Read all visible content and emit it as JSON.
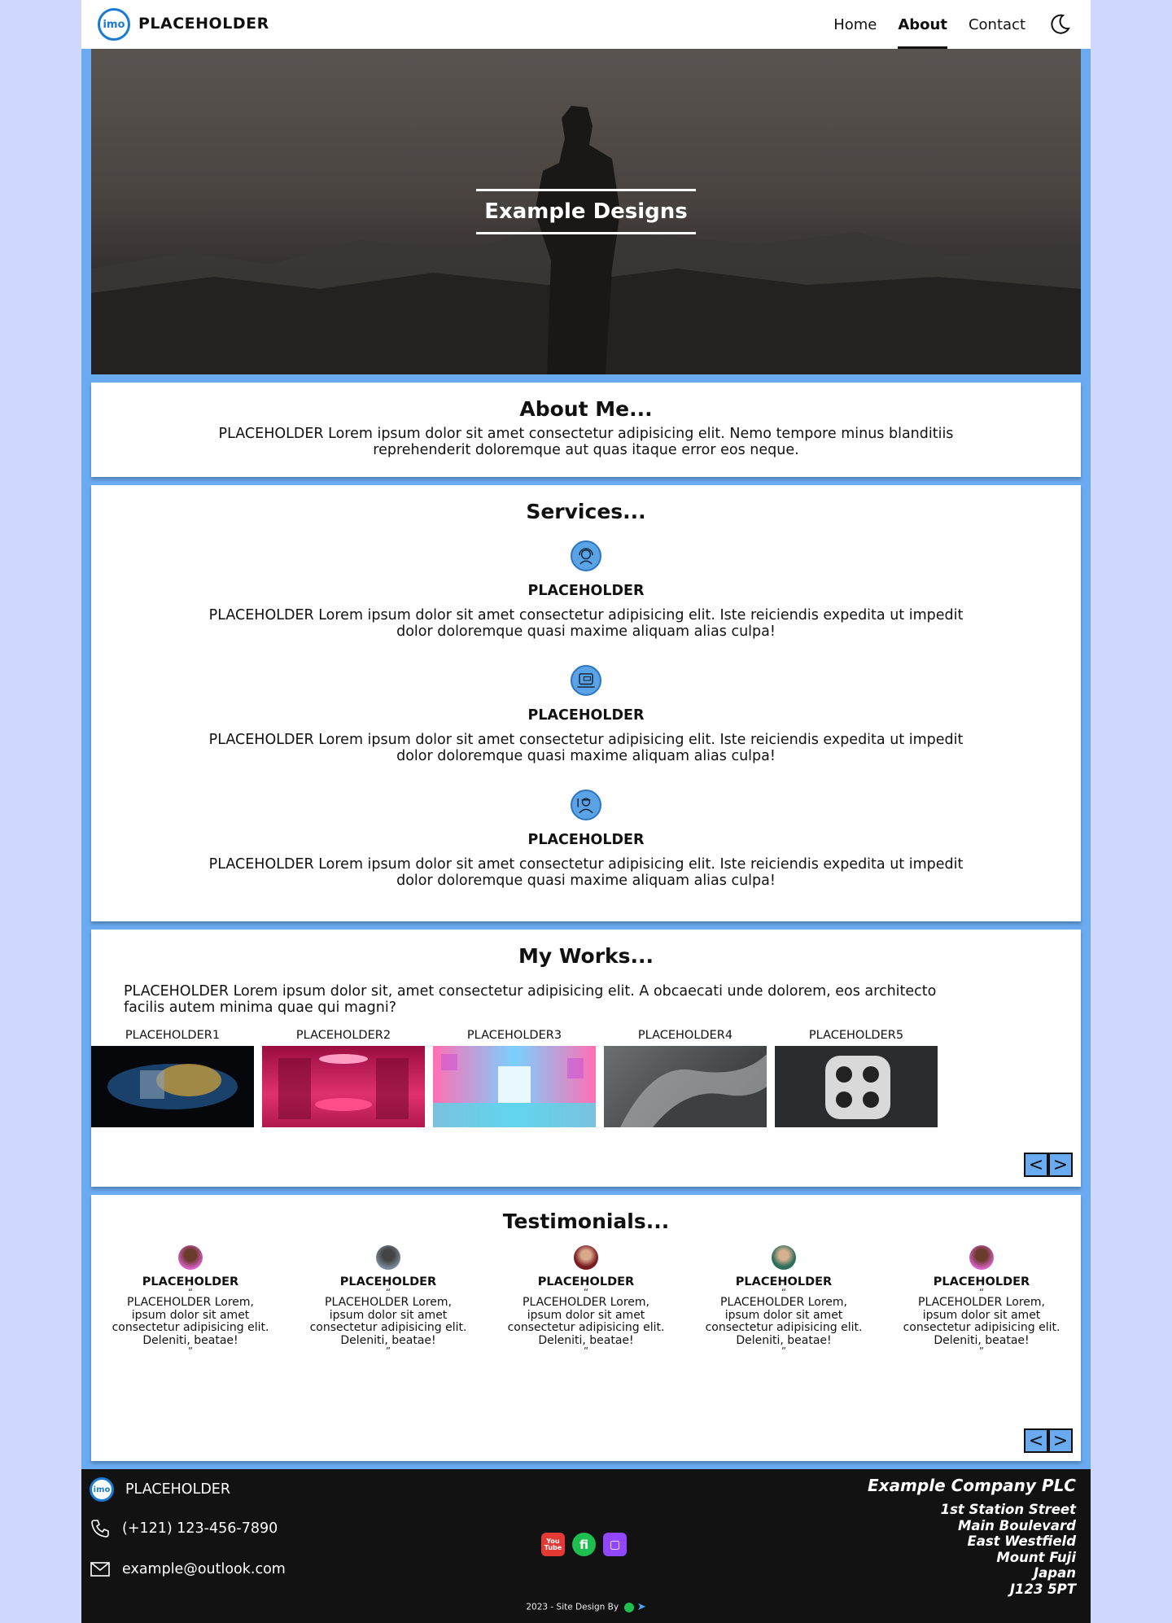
{
  "nav": {
    "logo_text": "imo",
    "brand": "PLACEHOLDER",
    "links": [
      "Home",
      "About",
      "Contact"
    ],
    "active": "About"
  },
  "hero": {
    "title": "Example Designs"
  },
  "about": {
    "title": "About Me...",
    "text_line1": "PLACEHOLDER Lorem ipsum dolor sit amet consectetur adipisicing elit. Nemo tempore minus blanditiis",
    "text_line2": "reprehenderit doloremque aut quas itaque error eos neque."
  },
  "services": {
    "title": "Services...",
    "items": [
      {
        "icon": "support-agent-icon",
        "title": "PLACEHOLDER",
        "line1": "PLACEHOLDER Lorem ipsum dolor sit amet consectetur adipisicing elit. Iste reiciendis expedita ut impedit",
        "line2": "dolor doloremque quasi maxime aliquam alias culpa!"
      },
      {
        "icon": "chat-laptop-icon",
        "title": "PLACEHOLDER",
        "line1": "PLACEHOLDER Lorem ipsum dolor sit amet consectetur adipisicing elit. Iste reiciendis expedita ut impedit",
        "line2": "dolor doloremque quasi maxime aliquam alias culpa!"
      },
      {
        "icon": "engineer-icon",
        "title": "PLACEHOLDER",
        "line1": "PLACEHOLDER Lorem ipsum dolor sit amet consectetur adipisicing elit. Iste reiciendis expedita ut impedit",
        "line2": "dolor doloremque quasi maxime aliquam alias culpa!"
      }
    ]
  },
  "works": {
    "title": "My Works...",
    "line1": "PLACEHOLDER Lorem ipsum dolor sit, amet consectetur adipisicing elit. A obcaecati unde dolorem, eos architecto",
    "line2": "facilis autem minima quae qui magni?",
    "items": [
      "PLACEHOLDER1",
      "PLACEHOLDER2",
      "PLACEHOLDER3",
      "PLACEHOLDER4",
      "PLACEHOLDER5"
    ],
    "prev": "<",
    "next": ">"
  },
  "testimonials": {
    "title": "Testimonials...",
    "items": [
      {
        "name": "PLACEHOLDER",
        "open_quote": "“",
        "close_quote": "”",
        "l1": "PLACEHOLDER Lorem,",
        "l2": "ipsum dolor sit amet",
        "l3": "consectetur adipisicing elit.",
        "l4": "Deleniti, beatae!"
      },
      {
        "name": "PLACEHOLDER",
        "open_quote": "“",
        "close_quote": "”",
        "l1": "PLACEHOLDER Lorem,",
        "l2": "ipsum dolor sit amet",
        "l3": "consectetur adipisicing elit.",
        "l4": "Deleniti, beatae!"
      },
      {
        "name": "PLACEHOLDER",
        "open_quote": "“",
        "close_quote": "”",
        "l1": "PLACEHOLDER Lorem,",
        "l2": "ipsum dolor sit amet",
        "l3": "consectetur adipisicing elit.",
        "l4": "Deleniti, beatae!"
      },
      {
        "name": "PLACEHOLDER",
        "open_quote": "“",
        "close_quote": "”",
        "l1": "PLACEHOLDER Lorem,",
        "l2": "ipsum dolor sit amet",
        "l3": "consectetur adipisicing elit.",
        "l4": "Deleniti, beatae!"
      },
      {
        "name": "PLACEHOLDER",
        "open_quote": "“",
        "close_quote": "”",
        "l1": "PLACEHOLDER Lorem,",
        "l2": "ipsum dolor sit amet",
        "l3": "consectetur adipisicing elit.",
        "l4": "Deleniti, beatae!"
      }
    ],
    "prev": "<",
    "next": ">"
  },
  "footer": {
    "logo_text": "imo",
    "brand": "PLACEHOLDER",
    "phone": "(+121) 123-456-7890",
    "email": "example@outlook.com",
    "company": "Example Company PLC",
    "address": [
      "1st Station Street",
      "Main Boulevard",
      "East Westfield",
      "Mount Fuji",
      "Japan",
      "J123 5PT"
    ],
    "social": [
      {
        "icon": "youtube-icon",
        "label": "You Tube",
        "color": "#e53935"
      },
      {
        "icon": "fiverr-icon",
        "label": "fi",
        "color": "#1dbf4f"
      },
      {
        "icon": "twitch-icon",
        "label": "▢",
        "color": "#9146ff"
      }
    ],
    "credit": "2023 - Site Design By"
  }
}
